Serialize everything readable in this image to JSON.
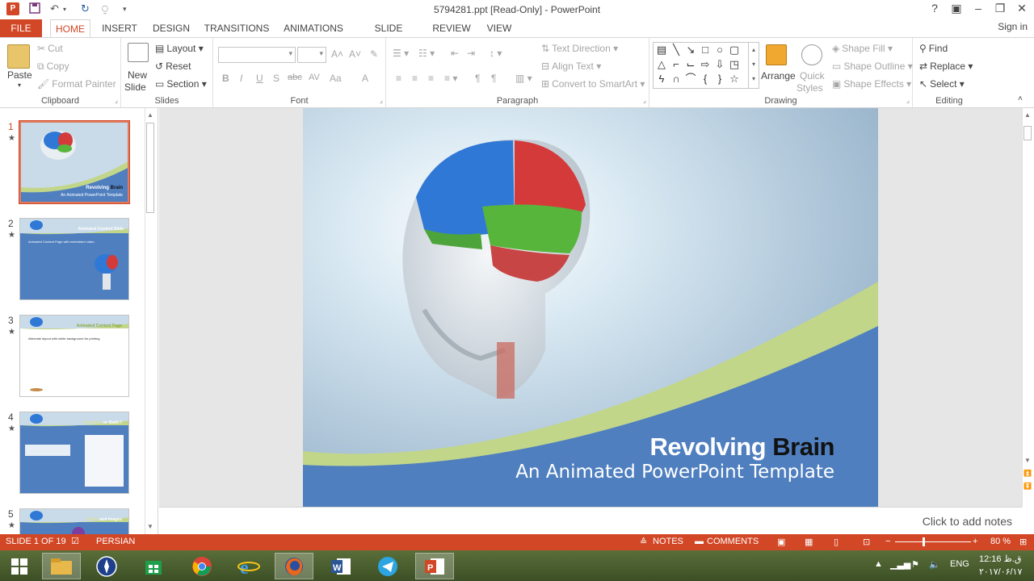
{
  "window": {
    "title": "5794281.ppt [Read-Only] - PowerPoint",
    "app_icon_letter": "P",
    "help": "?",
    "signin": "Sign in"
  },
  "tabs": [
    {
      "label": "FILE"
    },
    {
      "label": "HOME"
    },
    {
      "label": "INSERT"
    },
    {
      "label": "DESIGN"
    },
    {
      "label": "TRANSITIONS"
    },
    {
      "label": "ANIMATIONS"
    },
    {
      "label": "SLIDE SHOW"
    },
    {
      "label": "REVIEW"
    },
    {
      "label": "VIEW"
    }
  ],
  "ribbon": {
    "clipboard": {
      "label": "Clipboard",
      "paste": "Paste",
      "cut": "Cut",
      "copy": "Copy",
      "format_painter": "Format Painter"
    },
    "slides": {
      "label": "Slides",
      "new_slide_1": "New",
      "new_slide_2": "Slide",
      "layout": "Layout",
      "reset": "Reset",
      "section": "Section"
    },
    "font": {
      "label": "Font",
      "bold": "B",
      "italic": "I",
      "underline": "U",
      "shadow": "S",
      "strike": "abc",
      "spacing": "AV",
      "case": "Aa",
      "color": "A"
    },
    "paragraph": {
      "label": "Paragraph",
      "text_direction": "Text Direction",
      "align_text": "Align Text",
      "smartart": "Convert to SmartArt"
    },
    "drawing": {
      "label": "Drawing",
      "arrange": "Arrange",
      "quick_styles_1": "Quick",
      "quick_styles_2": "Styles",
      "shape_fill": "Shape Fill",
      "shape_outline": "Shape Outline",
      "shape_effects": "Shape Effects"
    },
    "editing": {
      "label": "Editing",
      "find": "Find",
      "replace": "Replace",
      "select": "Select"
    }
  },
  "thumbnails": [
    {
      "num": "1",
      "star": "★",
      "title_a": "Revolving",
      "title_b": "Brain",
      "sub": "An Animated PowerPoint Template"
    },
    {
      "num": "2",
      "star": "★",
      "title": "Animated Content Slide",
      "text": "Animated Content Page with embedded video."
    },
    {
      "num": "3",
      "star": "★",
      "title": "Animated Content Page",
      "text": "Alternate layout with white background for printing"
    },
    {
      "num": "4",
      "star": "★",
      "title_a": "Animation",
      "title_b": "or Static?"
    },
    {
      "num": "5",
      "star": "★",
      "title_a": "Useful",
      "title_b": "Images",
      "title_c": "and"
    }
  ],
  "slide": {
    "title_word1": "Revolving",
    "title_word2": "Brain",
    "subtitle": "An Animated PowerPoint Template"
  },
  "notes": {
    "placeholder": "Click to add notes"
  },
  "status": {
    "slide_count": "SLIDE 1 OF 19",
    "language": "PERSIAN",
    "notes": "NOTES",
    "comments": "COMMENTS",
    "zoom": "80 %"
  },
  "taskbar": {
    "language": "ENG",
    "time": "12:16 ق.ظ",
    "date": "۲۰۱۷/۰۶/۱۷"
  }
}
